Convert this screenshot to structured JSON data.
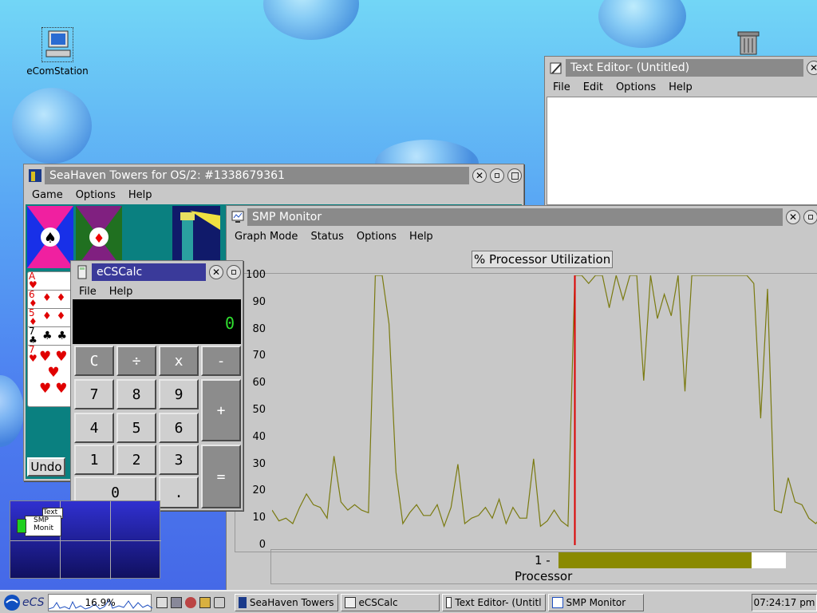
{
  "desktop": {
    "icons": [
      {
        "label": "eComStation",
        "icon": "computer-icon"
      },
      {
        "label": "",
        "icon": "trash-icon"
      }
    ]
  },
  "text_editor": {
    "title": "Text Editor- (Untitled)",
    "menu": [
      "File",
      "Edit",
      "Options",
      "Help"
    ],
    "close_glyph": "✕"
  },
  "seahaven": {
    "title": "SeaHaven Towers for OS/2: #1338679361",
    "menu": [
      "Game",
      "Options",
      "Help"
    ],
    "undo_label": "Undo",
    "cards": [
      {
        "rank": "A",
        "suit": "♥",
        "color": "red"
      },
      {
        "rank": "6",
        "suit": "♦",
        "color": "red"
      },
      {
        "rank": "5",
        "suit": "♦",
        "color": "red"
      },
      {
        "rank": "7",
        "suit": "♣",
        "color": "black"
      },
      {
        "rank": "7",
        "suit": "♥",
        "color": "red"
      }
    ],
    "foundations": [
      {
        "suit": "♠"
      },
      {
        "suit": "♦"
      }
    ]
  },
  "calc": {
    "title": "eCSCalc",
    "menu": [
      "File",
      "Help"
    ],
    "display": "0",
    "buttons": {
      "clear": "C",
      "divide": "÷",
      "multiply": "x",
      "minus": "-",
      "n7": "7",
      "n8": "8",
      "n9": "9",
      "plus": "+",
      "n4": "4",
      "n5": "5",
      "n6": "6",
      "n1": "1",
      "n2": "2",
      "n3": "3",
      "equals": "=",
      "n0": "0",
      "dot": "."
    }
  },
  "smp": {
    "title": "SMP Monitor",
    "menu": [
      "Graph Mode",
      "Status",
      "Options",
      "Help"
    ],
    "graph_title": "% Processor Utilization",
    "y_ticks": [
      "100",
      "90",
      "80",
      "70",
      "60",
      "50",
      "40",
      "30",
      "20",
      "10",
      "0"
    ],
    "processor_row_label": "1 -",
    "processor_caption": "Processor",
    "processor_load": 0.85,
    "colors": {
      "line": "#7a7a10",
      "cursor": "#dd0000",
      "bar": "#8a8a00"
    }
  },
  "chart_data": {
    "type": "line",
    "title": "% Processor Utilization",
    "ylim": [
      0,
      100
    ],
    "x": [
      0,
      1,
      2,
      3,
      4,
      5,
      6,
      7,
      8,
      9,
      10,
      11,
      12,
      13,
      14,
      15,
      16,
      17,
      18,
      19,
      20,
      21,
      22,
      23,
      24,
      25,
      26,
      27,
      28,
      29,
      30,
      31,
      32,
      33,
      34,
      35,
      36,
      37,
      38,
      39,
      40,
      41,
      42,
      43,
      44,
      45,
      46,
      47,
      48,
      49,
      50,
      51,
      52,
      53,
      54,
      55,
      56,
      57,
      58,
      59,
      60,
      61,
      62,
      63,
      64,
      65,
      66,
      67,
      68,
      69,
      70,
      71,
      72,
      73,
      74,
      75,
      76,
      77,
      78,
      79,
      80,
      81,
      82,
      83,
      84,
      85,
      86,
      87,
      88,
      89,
      90,
      91,
      92,
      93,
      94,
      95,
      96,
      97,
      98,
      99,
      100,
      101,
      102,
      103,
      104,
      105,
      106,
      107,
      108,
      109,
      110,
      111,
      112,
      113,
      114
    ],
    "series": [
      {
        "values": [
          13,
          9,
          10,
          8,
          14,
          19,
          15,
          14,
          10,
          33,
          16,
          13,
          15,
          13,
          12,
          100,
          100,
          82,
          27,
          8,
          12,
          15,
          11,
          11,
          15,
          7,
          14,
          30,
          8,
          10,
          11,
          14,
          10,
          17,
          8,
          14,
          10,
          10,
          32,
          7,
          9,
          13,
          9,
          7,
          100,
          100,
          97,
          100,
          100,
          88,
          100,
          91,
          100,
          100,
          61,
          100,
          84,
          93,
          85,
          100,
          57,
          100,
          100,
          100,
          100,
          100,
          100,
          100,
          100,
          100,
          97,
          47,
          95,
          13,
          12,
          25,
          16,
          15,
          10,
          8,
          11
        ],
        "segments": "right side of cursor continues line; values left of cursor occupy positions 0-43"
      }
    ]
  },
  "taskbar": {
    "logo": "eCS",
    "cpu_percent": "16.9%",
    "tasks": [
      "SeaHaven Towers",
      "eCSCalc",
      "Text Editor- (Untitl",
      "SMP Monitor"
    ],
    "clock": "07:24:17 pm",
    "pager_labels": [
      "Text",
      "SMP Monit"
    ]
  }
}
